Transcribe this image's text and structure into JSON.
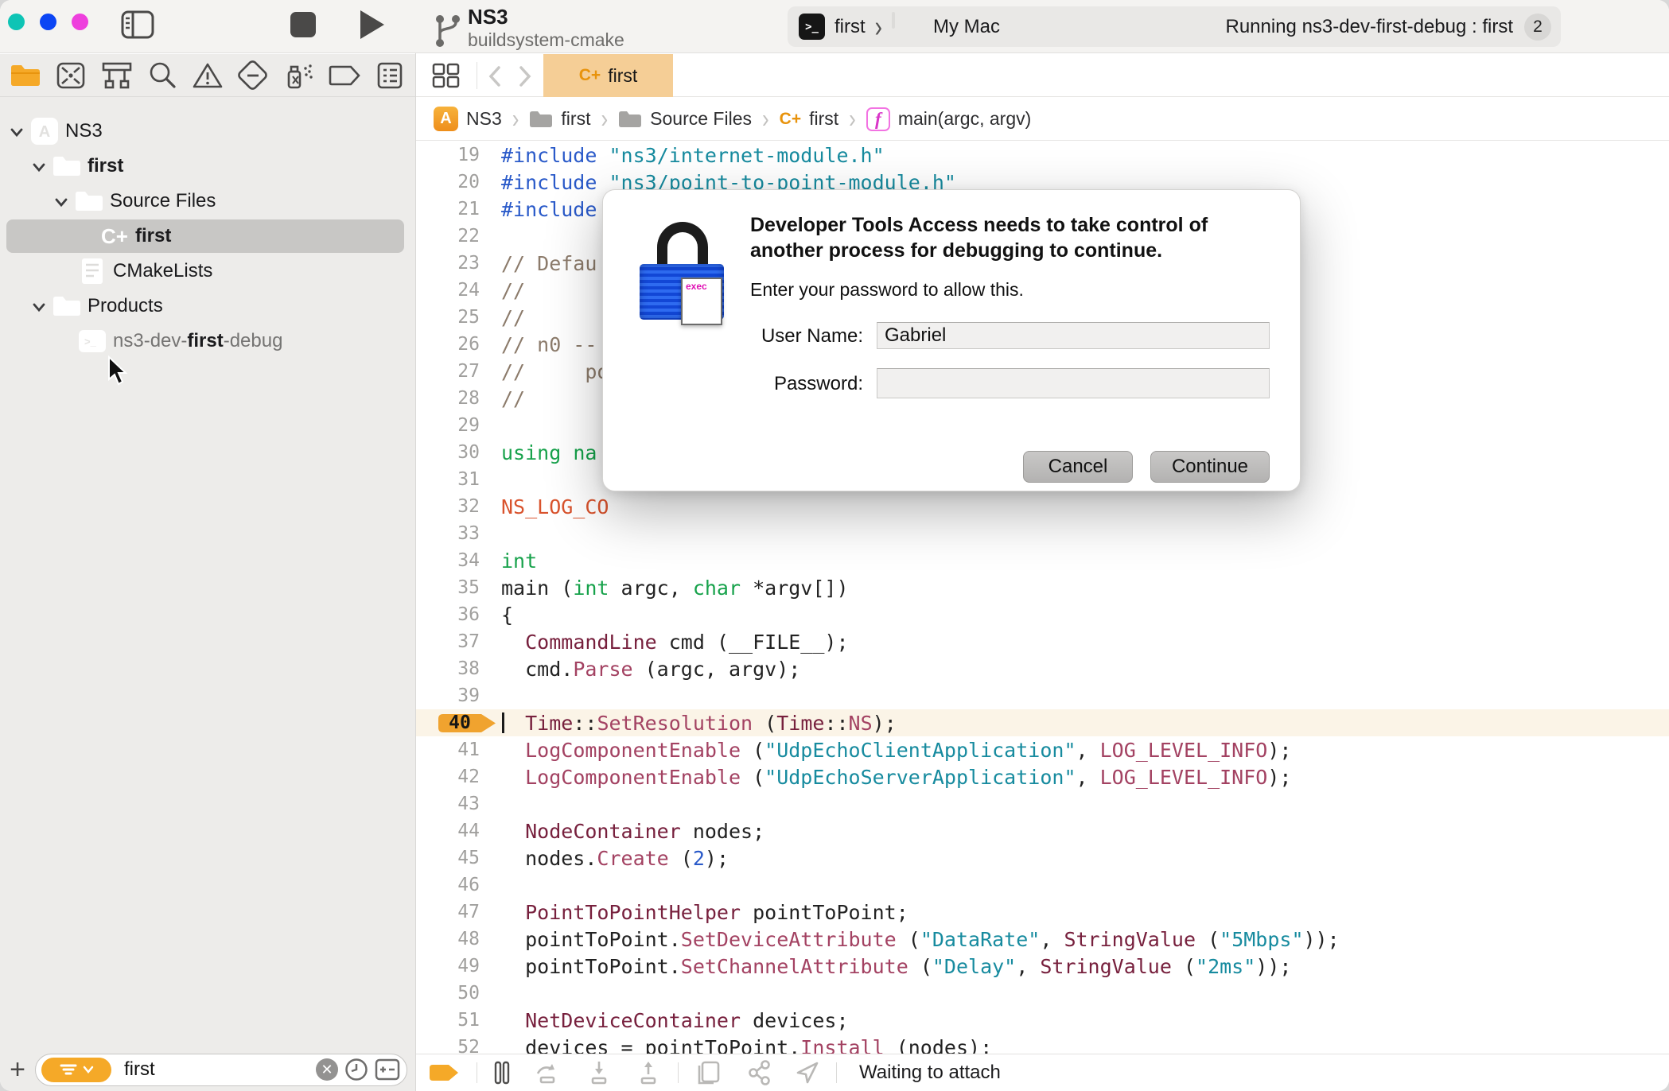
{
  "window": {
    "traffic_lights": [
      {
        "name": "close-button",
        "color": "#0EC4B5"
      },
      {
        "name": "minimize-button",
        "color": "#0B45F4"
      },
      {
        "name": "zoom-button",
        "color": "#EE3FDD"
      }
    ]
  },
  "toolbar": {
    "project_title": "NS3",
    "project_subtitle": "buildsystem-cmake",
    "scheme_terminal_glyph": ">_",
    "scheme_target": "first",
    "scheme_separator": "›",
    "scheme_destination": "My Mac",
    "status_text": "Running ns3-dev-first-debug : first",
    "status_badge": "2"
  },
  "navigator": {
    "icons": [
      "project-navigator-icon",
      "source-control-navigator-icon",
      "symbol-navigator-icon",
      "find-navigator-icon",
      "issue-navigator-icon",
      "test-navigator-icon",
      "debug-navigator-icon",
      "breakpoint-navigator-icon",
      "report-navigator-icon"
    ],
    "tree": [
      {
        "label": "NS3",
        "icon": "app-icon",
        "indent": 12,
        "chevron": true,
        "bold": false,
        "selected": false
      },
      {
        "label": "first",
        "icon": "folder-icon",
        "indent": 40,
        "chevron": true,
        "bold": true,
        "selected": false
      },
      {
        "label": "Source Files",
        "icon": "folder-icon",
        "indent": 68,
        "chevron": true,
        "bold": false,
        "selected": false
      },
      {
        "label": "first",
        "icon": "cpp-file-icon",
        "indent": 124,
        "chevron": false,
        "bold": true,
        "selected": true
      },
      {
        "label": "CMakeLists",
        "icon": "document-icon",
        "indent": 96,
        "chevron": false,
        "bold": false,
        "selected": false
      },
      {
        "label": "Products",
        "icon": "folder-icon",
        "indent": 40,
        "chevron": true,
        "bold": false,
        "selected": false
      },
      {
        "parts": [
          "ns3-dev-",
          "first",
          "-debug"
        ],
        "icon": "terminal-icon",
        "indent": 96,
        "chevron": false,
        "bold": false,
        "selected": false,
        "dimmed": true
      }
    ],
    "filter": {
      "value": "first"
    }
  },
  "tabbar": {
    "tabs": [
      {
        "icon_label": "C+",
        "label": "first",
        "active": true
      }
    ]
  },
  "breadcrumb": [
    {
      "icon": "app-icon",
      "label": "NS3"
    },
    {
      "icon": "folder-icon",
      "label": "first"
    },
    {
      "icon": "folder-icon",
      "label": "Source Files"
    },
    {
      "icon": "cpp-icon",
      "label": "first"
    },
    {
      "icon": "function-icon",
      "label": "main(argc, argv)"
    }
  ],
  "function_icon_glyph": "f",
  "editor": {
    "lines": [
      {
        "n": 19,
        "segs": [
          [
            "dir",
            "#include"
          ],
          [
            "pl",
            " "
          ],
          [
            "str",
            "\"ns3/internet-module.h\""
          ]
        ]
      },
      {
        "n": 20,
        "segs": [
          [
            "dir",
            "#include"
          ],
          [
            "pl",
            " "
          ],
          [
            "str",
            "\"ns3/point-to-point-module.h\""
          ]
        ]
      },
      {
        "n": 21,
        "segs": [
          [
            "dir",
            "#include"
          ]
        ]
      },
      {
        "n": 22,
        "segs": []
      },
      {
        "n": 23,
        "segs": [
          [
            "com",
            "// Defau"
          ]
        ]
      },
      {
        "n": 24,
        "segs": [
          [
            "com",
            "//"
          ]
        ]
      },
      {
        "n": 25,
        "segs": [
          [
            "com",
            "//"
          ]
        ]
      },
      {
        "n": 26,
        "segs": [
          [
            "com",
            "// n0 --"
          ]
        ]
      },
      {
        "n": 27,
        "segs": [
          [
            "com",
            "//     po"
          ]
        ]
      },
      {
        "n": 28,
        "segs": [
          [
            "com",
            "//"
          ]
        ]
      },
      {
        "n": 29,
        "segs": []
      },
      {
        "n": 30,
        "segs": [
          [
            "kw",
            "using"
          ],
          [
            "pl",
            " "
          ],
          [
            "kw",
            "na"
          ]
        ]
      },
      {
        "n": 31,
        "segs": []
      },
      {
        "n": 32,
        "segs": [
          [
            "mac",
            "NS_LOG_CO"
          ]
        ]
      },
      {
        "n": 33,
        "segs": []
      },
      {
        "n": 34,
        "segs": [
          [
            "kw",
            "int"
          ]
        ]
      },
      {
        "n": 35,
        "segs": [
          [
            "pl",
            "main ("
          ],
          [
            "kw",
            "int"
          ],
          [
            "pl",
            " argc, "
          ],
          [
            "kw",
            "char"
          ],
          [
            "pl",
            " *argv[])"
          ]
        ]
      },
      {
        "n": 36,
        "segs": [
          [
            "pl",
            "{"
          ]
        ]
      },
      {
        "n": 37,
        "segs": [
          [
            "pl",
            "  "
          ],
          [
            "ty",
            "CommandLine"
          ],
          [
            "pl",
            " cmd (__FILE__);"
          ]
        ]
      },
      {
        "n": 38,
        "segs": [
          [
            "pl",
            "  cmd."
          ],
          [
            "fn",
            "Parse"
          ],
          [
            "pl",
            " (argc, argv);"
          ]
        ]
      },
      {
        "n": 39,
        "segs": []
      },
      {
        "n": 40,
        "breakpoint": true,
        "caret": true,
        "segs": [
          [
            "pl",
            "  "
          ],
          [
            "ty",
            "Time"
          ],
          [
            "pl",
            "::"
          ],
          [
            "fn",
            "SetResolution"
          ],
          [
            "pl",
            " ("
          ],
          [
            "ty",
            "Time"
          ],
          [
            "pl",
            "::"
          ],
          [
            "fn",
            "NS"
          ],
          [
            "pl",
            ");"
          ]
        ]
      },
      {
        "n": 41,
        "segs": [
          [
            "pl",
            "  "
          ],
          [
            "fn",
            "LogComponentEnable"
          ],
          [
            "pl",
            " ("
          ],
          [
            "str",
            "\"UdpEchoClientApplication\""
          ],
          [
            "pl",
            ", "
          ],
          [
            "fn",
            "LOG_LEVEL_INFO"
          ],
          [
            "pl",
            ");"
          ]
        ]
      },
      {
        "n": 42,
        "segs": [
          [
            "pl",
            "  "
          ],
          [
            "fn",
            "LogComponentEnable"
          ],
          [
            "pl",
            " ("
          ],
          [
            "str",
            "\"UdpEchoServerApplication\""
          ],
          [
            "pl",
            ", "
          ],
          [
            "fn",
            "LOG_LEVEL_INFO"
          ],
          [
            "pl",
            ");"
          ]
        ]
      },
      {
        "n": 43,
        "segs": []
      },
      {
        "n": 44,
        "segs": [
          [
            "pl",
            "  "
          ],
          [
            "ty",
            "NodeContainer"
          ],
          [
            "pl",
            " nodes;"
          ]
        ]
      },
      {
        "n": 45,
        "segs": [
          [
            "pl",
            "  nodes."
          ],
          [
            "fn",
            "Create"
          ],
          [
            "pl",
            " ("
          ],
          [
            "num",
            "2"
          ],
          [
            "pl",
            ");"
          ]
        ]
      },
      {
        "n": 46,
        "segs": []
      },
      {
        "n": 47,
        "segs": [
          [
            "pl",
            "  "
          ],
          [
            "ty",
            "PointToPointHelper"
          ],
          [
            "pl",
            " pointToPoint;"
          ]
        ]
      },
      {
        "n": 48,
        "segs": [
          [
            "pl",
            "  pointToPoint."
          ],
          [
            "fn",
            "SetDeviceAttribute"
          ],
          [
            "pl",
            " ("
          ],
          [
            "str",
            "\"DataRate\""
          ],
          [
            "pl",
            ", "
          ],
          [
            "ty",
            "StringValue"
          ],
          [
            "pl",
            " ("
          ],
          [
            "str",
            "\"5Mbps\""
          ],
          [
            "pl",
            "));"
          ]
        ]
      },
      {
        "n": 49,
        "segs": [
          [
            "pl",
            "  pointToPoint."
          ],
          [
            "fn",
            "SetChannelAttribute"
          ],
          [
            "pl",
            " ("
          ],
          [
            "str",
            "\"Delay\""
          ],
          [
            "pl",
            ", "
          ],
          [
            "ty",
            "StringValue"
          ],
          [
            "pl",
            " ("
          ],
          [
            "str",
            "\"2ms\""
          ],
          [
            "pl",
            "));"
          ]
        ]
      },
      {
        "n": 50,
        "segs": []
      },
      {
        "n": 51,
        "segs": [
          [
            "pl",
            "  "
          ],
          [
            "ty",
            "NetDeviceContainer"
          ],
          [
            "pl",
            " devices;"
          ]
        ]
      },
      {
        "n": 52,
        "segs": [
          [
            "pl",
            "  devices = pointToPoint."
          ],
          [
            "fn",
            "Install"
          ],
          [
            "pl",
            " (nodes);"
          ]
        ]
      }
    ]
  },
  "dialog": {
    "title": "Developer Tools Access needs to take control of another process for debugging to continue.",
    "subtitle": "Enter your password to allow this.",
    "lock_badge": "exec",
    "username_label": "User Name:",
    "username_value": "Gabriel",
    "password_label": "Password:",
    "password_value": "",
    "cancel_label": "Cancel",
    "continue_label": "Continue"
  },
  "debugbar": {
    "items": [
      "breakpoints-toggle-icon",
      "divider",
      "pause-icon",
      "step-over-icon",
      "step-into-icon",
      "step-out-icon",
      "divider",
      "view-stack-icon",
      "threads-icon",
      "location-icon",
      "divider"
    ],
    "status": "Waiting to attach"
  },
  "colors": {
    "tab_active_bg": "#F5CE96",
    "breakpoint_orange": "#F0A32F",
    "filter_pill_orange": "#F5A928",
    "selected_row_gray": "#C8C7C5"
  }
}
